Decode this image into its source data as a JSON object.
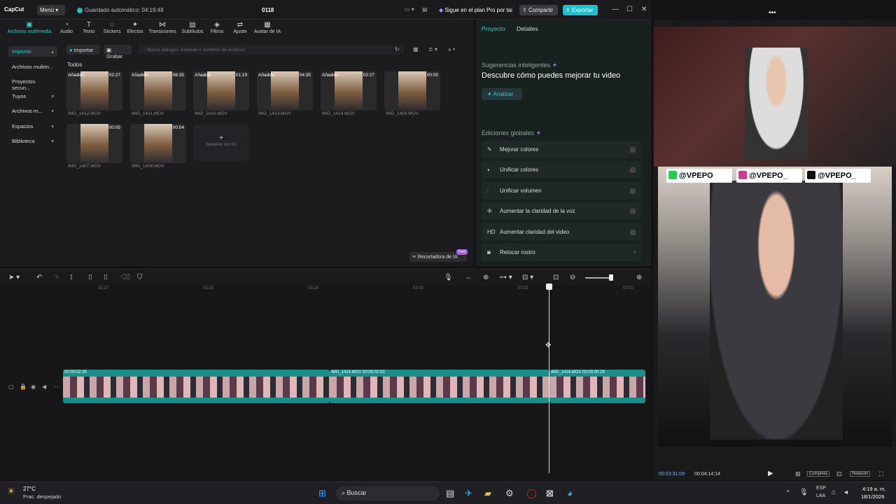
{
  "app": {
    "logo": "CapCut",
    "menu": "Menú",
    "autosave": "Guardado automático: 04:19:48",
    "project": "0118",
    "pro_text": "Sigue en el plan Pro por tai",
    "share": "Compartir",
    "export": "Exportar"
  },
  "tools": [
    {
      "label": "Archivos multimedia",
      "icon": "▣"
    },
    {
      "label": "Audio",
      "icon": "◔"
    },
    {
      "label": "Texto",
      "icon": "T"
    },
    {
      "label": "Stickers",
      "icon": "◌"
    },
    {
      "label": "Efectos",
      "icon": "✦"
    },
    {
      "label": "Transiciones",
      "icon": "⋈"
    },
    {
      "label": "Subtítulos",
      "icon": "▤"
    },
    {
      "label": "Filtros",
      "icon": "◈"
    },
    {
      "label": "Ajuste",
      "icon": "⇄"
    },
    {
      "label": "Avatar de IA",
      "icon": "▦"
    }
  ],
  "sidebar": [
    {
      "label": "Importar"
    },
    {
      "label": "Archivos multim..."
    },
    {
      "label": "Proyectos secun..."
    },
    {
      "label": "Tuyos"
    },
    {
      "label": "Archivos m..."
    },
    {
      "label": "Espacios"
    },
    {
      "label": "Biblioteca"
    }
  ],
  "media": {
    "import": "Importar",
    "record": "Grabar",
    "search_placeholder": "Busca diálogos, escenas o nombres de archivos",
    "section": "Todos",
    "items": [
      {
        "tag": "Añadido",
        "dur": "02:27",
        "name": "IMG_1412.MOV"
      },
      {
        "tag": "Añadido",
        "dur": "06:35",
        "name": "IMG_1411.MOV"
      },
      {
        "tag": "Añadido",
        "dur": "01:19",
        "name": "IMG_1410.MOV"
      },
      {
        "tag": "Añadido",
        "dur": "04:35",
        "name": "IMG_1413.MOV"
      },
      {
        "tag": "Añadido",
        "dur": "02:27",
        "name": "IMG_1414.MOV"
      },
      {
        "tag": "",
        "dur": "00:05",
        "name": "IMG_1409.MOV"
      },
      {
        "tag": "",
        "dur": "00:05",
        "name": "IMG_1407.MOV"
      },
      {
        "tag": "",
        "dur": "00:04",
        "name": "IMG_1408.MOV"
      }
    ],
    "generate": "Generar con IA",
    "ai_cutter": "Recortadora de IA",
    "ai_badge": "Free"
  },
  "panel": {
    "tab_project": "Proyecto",
    "tab_details": "Detalles",
    "suggestions": "Sugerencias inteligentes",
    "suggestion_text": "Descubre cómo puedes mejorar tu video",
    "analyze": "Analizar",
    "global": "Ediciones globales",
    "rows": [
      {
        "label": "Mejorar colores",
        "icon": "✎"
      },
      {
        "label": "Unificar colores",
        "icon": "◐"
      },
      {
        "label": "Unificar volumen",
        "icon": "⫶"
      },
      {
        "label": "Aumentar la claridad de la voz",
        "icon": "✣"
      },
      {
        "label": "Aumentar claridad del video",
        "icon": "HD"
      },
      {
        "label": "Retocar rostro",
        "icon": "◙"
      }
    ]
  },
  "timeline": {
    "ticks": [
      "03:27",
      "03:28",
      "03:29",
      "03:30",
      "03:31",
      "03:32"
    ],
    "clips": [
      {
        "label": "00:00:02:28"
      },
      {
        "label": "IMG_1414.MOV   00:00:02:03"
      },
      {
        "label": "IMG_1414.MOV   00:00:00:29"
      }
    ]
  },
  "cam": {
    "handles": [
      "@VPEPO",
      "@VPEPO_",
      "@VPEPO_"
    ],
    "time_current": "00:03:31:09",
    "time_total": "00:04:14:14",
    "btn_full": "Completa",
    "btn_ratio": "Relación"
  },
  "taskbar": {
    "temp": "27°C",
    "weather": "Prac. despejado",
    "search": "Buscar",
    "lang": "ESP",
    "lang2": "LAA",
    "time": "4:19 a. m.",
    "date": "18/1/2026"
  },
  "colors": {
    "accent": "#2ed0d0",
    "export": "#1fbfcf",
    "clip": "#1a8f8a"
  }
}
